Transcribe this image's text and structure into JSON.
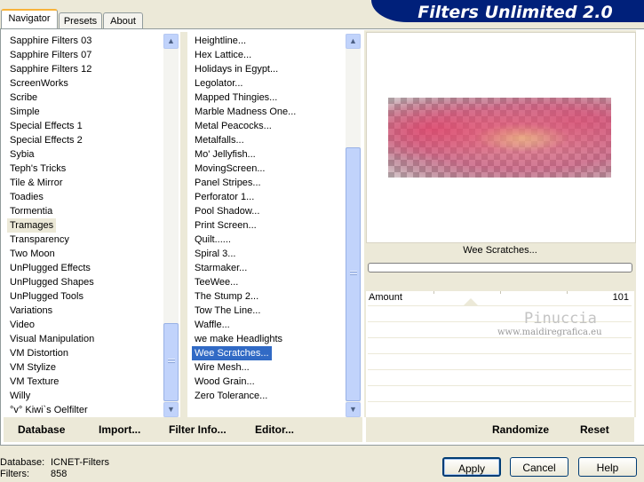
{
  "tabs": [
    {
      "label": "Navigator"
    },
    {
      "label": "Presets"
    },
    {
      "label": "About"
    }
  ],
  "banner_title": "Filters Unlimited 2.0",
  "categories": [
    "Sapphire Filters 03",
    "Sapphire Filters 07",
    "Sapphire Filters 12",
    "ScreenWorks",
    "Scribe",
    "Simple",
    "Special Effects 1",
    "Special Effects 2",
    "Sybia",
    "Teph's Tricks",
    "Tile & Mirror",
    "Toadies",
    "Tormentia",
    "Tramages",
    "Transparency",
    "Two Moon",
    "UnPlugged Effects",
    "UnPlugged Shapes",
    "UnPlugged Tools",
    "Variations",
    "Video",
    "Visual Manipulation",
    "VM Distortion",
    "VM Stylize",
    "VM Texture",
    "Willy",
    "°v° Kiwi`s Oelfilter"
  ],
  "selected_category": "Tramages",
  "filters": [
    "Heightline...",
    "Hex Lattice...",
    "Holidays in Egypt...",
    "Legolator...",
    "Mapped Thingies...",
    "Marble Madness One...",
    "Metal Peacocks...",
    "Metalfalls...",
    "Mo' Jellyfish...",
    "MovingScreen...",
    "Panel Stripes...",
    "Perforator 1...",
    "Pool Shadow...",
    "Print Screen...",
    "Quilt......",
    "Spiral 3...",
    "Starmaker...",
    "TeeWee...",
    "The Stump 2...",
    "Tow The Line...",
    "Waffle...",
    "we make Headlights",
    "Wee Scratches...",
    "Wire Mesh...",
    "Wood Grain...",
    "Zero Tolerance..."
  ],
  "selected_filter": "Wee Scratches...",
  "filter_name": "Wee Scratches...",
  "progress": 0,
  "params": [
    {
      "label": "Amount",
      "value": "101"
    }
  ],
  "watermark": {
    "name": "Pinuccia",
    "url": "www.maidiregrafica.eu"
  },
  "bottom_links": {
    "database": "Database",
    "import": "Import...",
    "filter_info": "Filter Info...",
    "editor": "Editor...",
    "randomize": "Randomize",
    "reset": "Reset"
  },
  "status": {
    "database_label": "Database:",
    "database_value": "ICNET-Filters",
    "filters_label": "Filters:",
    "filters_value": "858"
  },
  "buttons": {
    "apply": "Apply",
    "cancel": "Cancel",
    "help": "Help"
  },
  "icons": {
    "scroll_up": "chevron-up-icon",
    "scroll_down": "chevron-down-icon"
  }
}
